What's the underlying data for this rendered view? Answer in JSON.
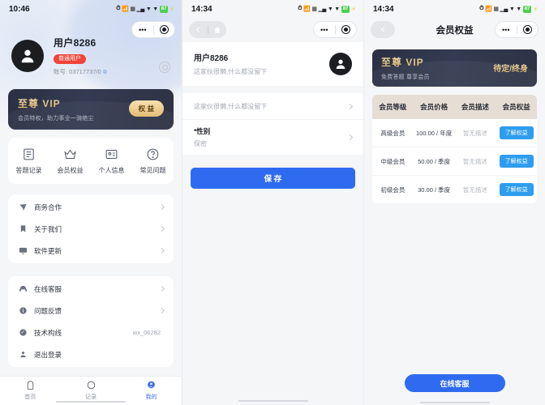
{
  "panel1": {
    "status": {
      "time": "10:46",
      "battery": "87"
    },
    "capsule": {
      "dots": "•••",
      "target": "target-icon"
    },
    "profile": {
      "name": "用户8286",
      "badge": "普通用户",
      "account": "账号: 03717737/0",
      "copy_icon": "copy-icon"
    },
    "vip": {
      "title": "至尊 VIP",
      "subtitle": "会员特权，助力事业一骑绝尘",
      "button": "权 益"
    },
    "grid": [
      {
        "icon": "document-icon",
        "label": "答题记录"
      },
      {
        "icon": "crown-icon",
        "label": "会员权益"
      },
      {
        "icon": "id-card-icon",
        "label": "个人信息"
      },
      {
        "icon": "question-icon",
        "label": "常见问题"
      }
    ],
    "list1": [
      {
        "icon": "send-icon",
        "label": "商务合作",
        "value": "",
        "chevron": true
      },
      {
        "icon": "bookmark-icon",
        "label": "关于我们",
        "value": "",
        "chevron": true
      },
      {
        "icon": "monitor-icon",
        "label": "软件更新",
        "value": "",
        "chevron": true
      }
    ],
    "list2": [
      {
        "icon": "headset-icon",
        "label": "在线客服",
        "value": "",
        "chevron": true
      },
      {
        "icon": "info-icon",
        "label": "问题反馈",
        "value": "",
        "chevron": true
      },
      {
        "icon": "wechat-icon",
        "label": "技术构线",
        "value": "wx_06282",
        "chevron": false
      },
      {
        "icon": "person-icon",
        "label": "退出登录",
        "value": "",
        "chevron": false
      }
    ],
    "tabs": [
      {
        "icon": "home-icon",
        "label": "首页",
        "active": false
      },
      {
        "icon": "record-icon",
        "label": "记录",
        "active": false
      },
      {
        "icon": "mine-icon",
        "label": "我的",
        "active": true
      }
    ]
  },
  "panel2": {
    "status": {
      "time": "14:34",
      "battery": "87"
    },
    "nav": {
      "back_icon": "back-arrow-icon",
      "home_icon": "home-icon",
      "title": ""
    },
    "header": {
      "name": "用户8286",
      "desc": "这家伙很懒,什么都没留下",
      "avatar": "avatar-icon"
    },
    "fields": [
      {
        "label": "",
        "value": "这家伙很懒,什么都没留下",
        "single": true
      },
      {
        "label": "*性别",
        "value": "保密",
        "single": false
      }
    ],
    "save_button": "保 存"
  },
  "panel3": {
    "status": {
      "time": "14:34",
      "battery": "87"
    },
    "nav": {
      "back_icon": "back-arrow-icon",
      "title": "会员权益"
    },
    "vip": {
      "title": "至尊 VIP",
      "subtitle": "免费答题 尊享会员",
      "right": "待定/终身"
    },
    "table": {
      "headers": [
        "会员等级",
        "会员价格",
        "会员描述",
        "会员权益"
      ],
      "rows": [
        {
          "level": "高级会员",
          "price": "100.00 / 年度",
          "desc": "暂无描述",
          "action": "了解权益"
        },
        {
          "level": "中级会员",
          "price": "50.00 / 季度",
          "desc": "暂无描述",
          "action": "了解权益"
        },
        {
          "level": "初级会员",
          "price": "30.00 / 季度",
          "desc": "暂无描述",
          "action": "了解权益"
        }
      ]
    },
    "service_button": "在线客服"
  },
  "colors": {
    "primary": "#2e6bf0",
    "badge_red": "#f0453a",
    "vip_gold": "#e4bd77",
    "table_header": "#e6ddd5",
    "table_button": "#2e9df0"
  }
}
